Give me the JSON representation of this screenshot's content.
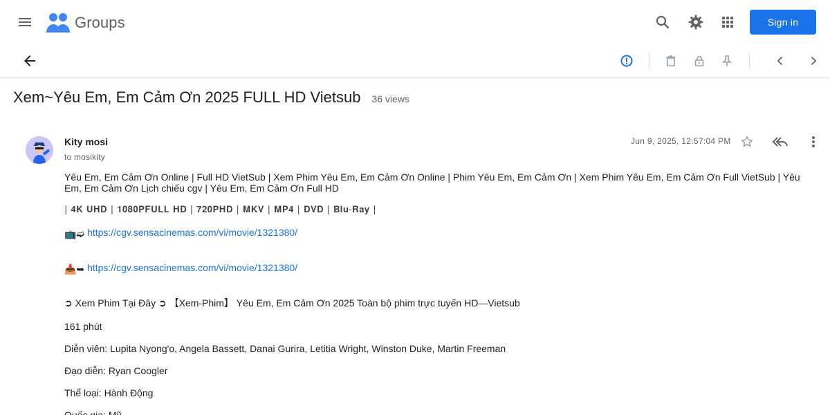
{
  "header": {
    "app_name": "Groups",
    "sign_in_label": "Sign in",
    "accent_color": "#1a73e8",
    "icons": [
      "menu-icon",
      "groups-logo-icon",
      "search-icon",
      "gear-icon",
      "apps-grid-icon"
    ]
  },
  "toolbar": {
    "icons": [
      "back-arrow-icon",
      "report-icon",
      "delete-icon",
      "lock-icon",
      "pin-icon",
      "chevron-left-icon",
      "chevron-right-icon"
    ]
  },
  "thread": {
    "title": "Xem~Yêu Em, Em Cảm Ơn 2025 FULL HD Vietsub",
    "views": "36 views"
  },
  "message": {
    "author": "Kity mosi",
    "recipient": "to mosikity",
    "date": "Jun 9, 2025, 12:57:04 PM",
    "paragraphs": {
      "intro": "Yêu Em, Em Cảm Ơn Online | Full HD VietSub | Xem Phim Yêu Em, Em Cảm Ơn Online | Phim Yêu Em, Em Cảm Ơn | Xem Phim Yêu Em, Em Cảm Ơn Full VietSub | Yêu Em, Em Cảm Ơn Lịch chiếu cgv | Yêu Em, Em Cảm Ơn Full HD",
      "formats": "| 𝟒𝐊 𝐔𝐇𝐃 | 𝟏𝟎𝟖𝟎𝐏𝐅𝐔𝐋𝐋 𝐇𝐃 | 𝟕𝟐𝟎𝐏𝐇𝐃 | 𝐌𝐊𝐕 | 𝐌𝐏𝟒 | 𝐃𝐕𝐃 | 𝐁𝐥𝐮-𝐑𝐚𝐲 |",
      "link1_prefix": "📺➫",
      "link1": "https://cgv.sensacinemas.com/vi/movie/1321380/",
      "link2_prefix": "📥➥",
      "link2": "https://cgv.sensacinemas.com/vi/movie/1321380/",
      "watch": "➲ Xem Phim Tại Đây ➲ 【Xem-Phim】 Yêu Em, Em Cảm Ơn 2025 Toàn bộ phim trực tuyến HD—Vietsub",
      "duration": "161 phút",
      "cast": "Diễn viên: Lupita Nyong'o, Angela Bassett, Danai Gurira, Letitia Wright, Winston Duke, Martin Freeman",
      "director": "Đạo diễn: Ryan Coogler",
      "genre": "Thể loại: Hành Động",
      "country": "Quốc gia: Mỹ"
    }
  }
}
